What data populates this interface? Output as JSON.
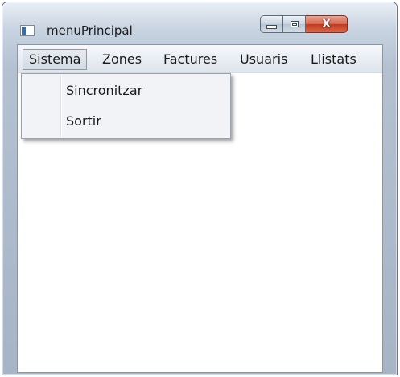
{
  "window": {
    "title": "menuPrincipal",
    "close_glyph": "X"
  },
  "menubar": {
    "items": [
      {
        "label": "Sistema",
        "open": true
      },
      {
        "label": "Zones"
      },
      {
        "label": "Factures"
      },
      {
        "label": "Usuaris"
      },
      {
        "label": "Llistats"
      }
    ]
  },
  "dropdown": {
    "items": [
      {
        "label": "Sincronitzar"
      },
      {
        "label": "Sortir"
      }
    ]
  },
  "colors": {
    "close_button": "#c0391f",
    "accent": "#2f6fb8"
  }
}
